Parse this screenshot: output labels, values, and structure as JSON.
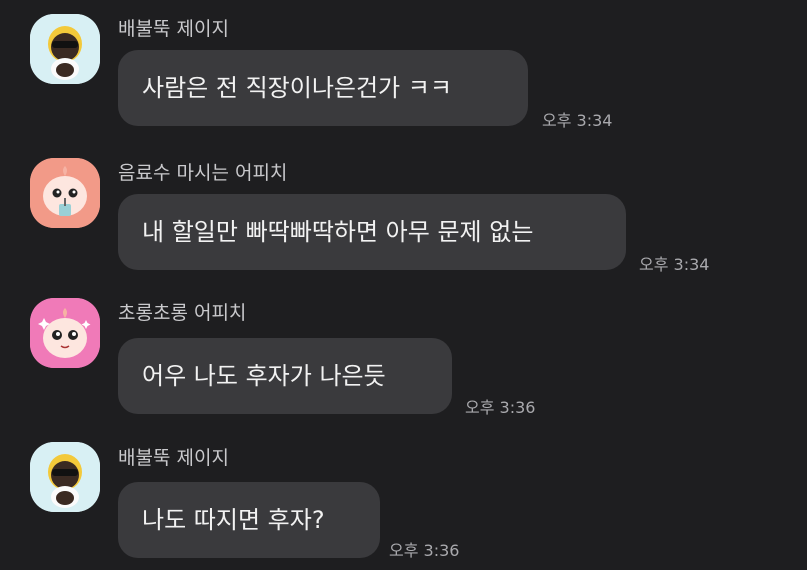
{
  "messages": [
    {
      "sender": "배불뚝 제이지",
      "text": "사람은 전 직장이나은건가 ㅋㅋ",
      "time": "오후 3:34",
      "avatar_icon": "jay-g-character-icon",
      "avatar_bg": "#d8f0f4"
    },
    {
      "sender": "음료수 마시는 어피치",
      "text": "내 할일만 빠딱빠딱하면 아무 문제 없는",
      "time": "오후 3:34",
      "avatar_icon": "apeach-drinking-icon",
      "avatar_bg": "#f29a88"
    },
    {
      "sender": "초롱초롱 어피치",
      "text": "어우 나도 후자가 나은듯",
      "time": "오후 3:36",
      "avatar_icon": "apeach-sparkle-icon",
      "avatar_bg": "#f07ab8"
    },
    {
      "sender": "배불뚝 제이지",
      "text": "나도 따지면 후자?",
      "time": "오후 3:36",
      "avatar_icon": "jay-g-character-icon",
      "avatar_bg": "#d8f0f4"
    }
  ]
}
